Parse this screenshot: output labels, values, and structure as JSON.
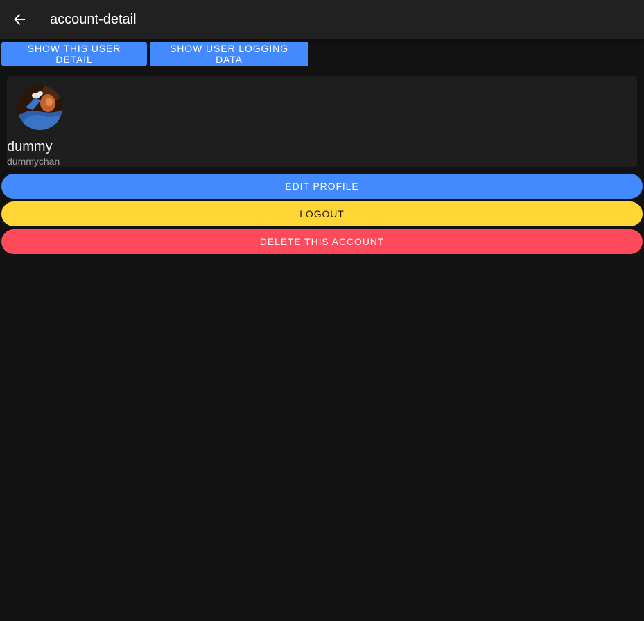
{
  "appbar": {
    "title": "account-detail",
    "back_icon": "arrow-left-icon"
  },
  "toggles": {
    "show_user_detail": "SHOW THIS USER DETAIL",
    "show_logging_data": "SHOW USER LOGGING DATA"
  },
  "profile": {
    "avatar_icon": "user-avatar-photo",
    "display_name": "dummy",
    "username": "dummychan"
  },
  "actions": {
    "edit_profile": "EDIT PROFILE",
    "logout": "LOGOUT",
    "delete_account": "DELETE THIS ACCOUNT"
  },
  "colors": {
    "background": "#121212",
    "appbar": "#212121",
    "card": "#1e1e1e",
    "primary": "#448aff",
    "warning": "#ffd633",
    "danger": "#ff4a5c"
  }
}
